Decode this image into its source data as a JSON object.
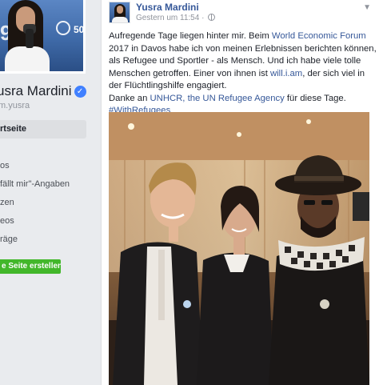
{
  "profile": {
    "name": "usra Mardini",
    "handle": "m.yusra",
    "nav": [
      {
        "label": "rtseite",
        "active": true
      },
      {
        "label": "",
        "active": false
      },
      {
        "label": "os",
        "active": false
      },
      {
        "label": "fällt mir\"-Angaben",
        "active": false
      },
      {
        "label": "zen",
        "active": false
      },
      {
        "label": "eos",
        "active": false
      },
      {
        "label": "räge",
        "active": false
      }
    ],
    "create_page_label": "e Seite erstellen",
    "pic_text": "9",
    "pic_logo_text": "50"
  },
  "post": {
    "author": "Yusra Mardini",
    "timestamp": "Gestern um 11:54",
    "separator": " · ",
    "text_parts": {
      "p1_a": "Aufregende Tage liegen hinter mir. Beim ",
      "p1_link": "World Economic Forum",
      "p1_b": " 2017 in Davos habe ich von meinen Erlebnissen berichten können, als Refugee und Sportler - als Mensch. Und ich habe viele tolle Menschen getroffen. Einer von ihnen ist ",
      "p1_link2": "will.i.am",
      "p1_c": ", der sich viel in der Flüchtlingshilfe engagiert.",
      "p2_a": "Danke an ",
      "p2_link": "UNHCR, the UN Refugee Agency",
      "p2_b": " für diese Tage.",
      "hashtag": "#WithRefugees"
    }
  },
  "colors": {
    "link": "#365899",
    "verified": "#4080ff",
    "create_button": "#42b72a"
  }
}
